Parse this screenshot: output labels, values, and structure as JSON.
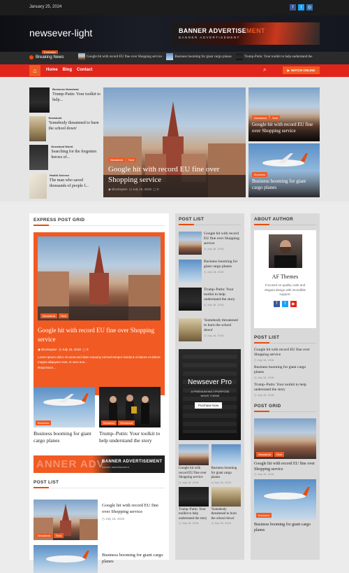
{
  "topbar": {
    "date": "January 25, 2024"
  },
  "header": {
    "site_title": "newsever-light",
    "banner_title_a": "BANNER ADVERTISE",
    "banner_title_b": "MENT",
    "banner_sub": "BANNER ADVERTISEMENT"
  },
  "ticker": {
    "label": "Breaking News",
    "badge": "Exclusive",
    "items": [
      "Google hit with record EU fine over Shopping service",
      "Business booming for giant cargo planes",
      "Trump-Putin: Your toolkit to help understand the"
    ]
  },
  "nav": {
    "items": [
      "Home",
      "Blog",
      "Contact"
    ],
    "watch_label": "WATCH ONLINE"
  },
  "hero_left": [
    {
      "cats": "Business  Newsbeat",
      "title": "Trump-Putin: Your toolkit to help..."
    },
    {
      "cats": "Newsbeat",
      "title": "'Somebody threatened to burn the school down'"
    },
    {
      "cats": "Newsbeat  World",
      "title": "Searching for the forgotten heroes of..."
    },
    {
      "cats": "Health  Science",
      "title": "The man who saved thousands of people f..."
    }
  ],
  "hero_main": {
    "tags": [
      "Newsbeat",
      "Tech"
    ],
    "title": "Google hit with record EU fine over Shopping service",
    "author": "Blockspare",
    "date": "July 18, 2018",
    "comments": "0"
  },
  "hero_right": [
    {
      "tags": [
        "Newsbeat",
        "Tech"
      ],
      "title": "Google hit with record EU fine over Shopping service"
    },
    {
      "tags": [
        "Business"
      ],
      "title": "Business booming for giant cargo planes"
    }
  ],
  "express": {
    "title": "EXPRESS POST GRID",
    "main": {
      "tags": [
        "Newsbeat",
        "Tech"
      ],
      "title": "Google hit with record EU fine over Shopping service",
      "author": "Blockspare",
      "date": "July 18, 2018",
      "comments": "0",
      "excerpt": "Lorem ipsum dolor sit amet,sed diam nonumy eirmod tempor invidunt ut labore et dolore magna aliquyam erat, At vero eos...",
      "read_more": "Read More..."
    },
    "small": [
      {
        "tags": [
          "Business"
        ],
        "title": "Business booming for giant cargo planes"
      },
      {
        "tags": [
          "Business",
          "Newsbeat"
        ],
        "title": "Trump–Putin: Your toolkit to help understand the story"
      }
    ]
  },
  "banner2": {
    "text_a": "BANNER ADVERTISEMENT",
    "text_b": "banner advertisement"
  },
  "post_list_left": {
    "title": "POST LIST",
    "items": [
      {
        "tags": [
          "Newsbeat",
          "Tech"
        ],
        "title": "Google hit with record EU fine over Shopping service",
        "date": "July 18, 2018"
      },
      {
        "tags": [],
        "title": "Business booming for giant cargo planes",
        "date": ""
      }
    ]
  },
  "post_list_mid": {
    "title": "POST LIST",
    "items": [
      {
        "title": "Google hit with record EU fine over Shopping service",
        "date": "July 18, 2018"
      },
      {
        "title": "Business booming for giant cargo planes",
        "date": "July 18, 2018"
      },
      {
        "title": "Trump–Putin: Your toolkit to help understand the story",
        "date": "July 18, 2018"
      },
      {
        "title": "'Somebody threatened to burn the school down'",
        "date": "July 18, 2018"
      }
    ]
  },
  "promo": {
    "title": "Newsever Pro",
    "sub": "A PREMIUM MULTIPURPOSE NEWS THEME",
    "button": "Purchase Now"
  },
  "mid_grid": [
    {
      "title": "Google hit with record EU fine over Shopping service",
      "date": "July 18, 2018"
    },
    {
      "title": "Business booming for giant cargo planes",
      "date": "July 18, 2018"
    },
    {
      "title": "Trump–Putin: Your toolkit to help understand the story",
      "date": "July 18, 2018"
    },
    {
      "title": "'Somebody threatened to burn the school down'",
      "date": "July 18, 2018"
    }
  ],
  "about": {
    "title": "ABOUT AUTHOR",
    "name": "AF Themes",
    "desc": "Focused on quality code and elegant design with incredible support."
  },
  "right_post_list": {
    "title": "POST LIST",
    "items": [
      {
        "title": "Google hit with record EU fine over Shopping service",
        "date": "July 18, 2018"
      },
      {
        "title": "Business booming for giant cargo planes",
        "date": "July 18, 2018"
      },
      {
        "title": "Trump–Putin: Your toolkit to help understand the story",
        "date": "July 18, 2018"
      }
    ]
  },
  "right_post_grid": {
    "title": "POST GRID",
    "items": [
      {
        "tags": [
          "Newsbeat",
          "Tech"
        ],
        "title": "Google hit with record EU fine over Shopping service",
        "date": "July 18, 2018"
      },
      {
        "tags": [
          "Business"
        ],
        "title": "Business booming for giant cargo planes",
        "date": ""
      }
    ]
  }
}
